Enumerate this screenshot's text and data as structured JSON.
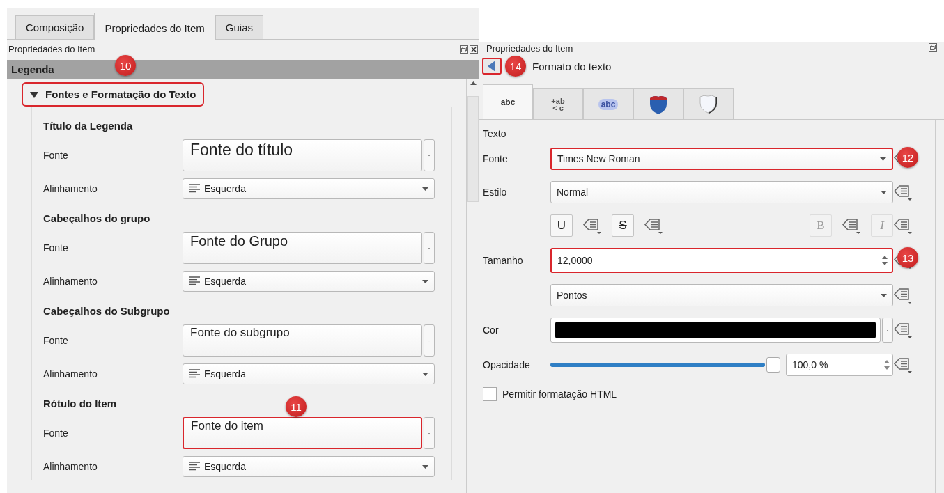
{
  "left_panel": {
    "tabs": [
      {
        "label": "Composição",
        "selected": false
      },
      {
        "label": "Propriedades do Item",
        "selected": true
      },
      {
        "label": "Guias",
        "selected": false
      }
    ],
    "title": "Propriedades do Item",
    "section_bar": "Legenda",
    "group": {
      "label": "Fontes e Formatação do Texto",
      "expanded": true,
      "highlighted": true,
      "badge": "10"
    },
    "subsections": [
      {
        "heading": "Título da Legenda",
        "rows": [
          {
            "kind": "font",
            "label": "Fonte",
            "value": "Fonte do título",
            "highlighted": false
          },
          {
            "kind": "align",
            "label": "Alinhamento",
            "value": "Esquerda"
          }
        ]
      },
      {
        "heading": "Cabeçalhos do grupo",
        "rows": [
          {
            "kind": "font",
            "label": "Fonte",
            "value": "Fonte do Grupo",
            "highlighted": false
          },
          {
            "kind": "align",
            "label": "Alinhamento",
            "value": "Esquerda"
          }
        ]
      },
      {
        "heading": "Cabeçalhos do Subgrupo",
        "rows": [
          {
            "kind": "font",
            "label": "Fonte",
            "value": "Fonte do subgrupo",
            "highlighted": false
          },
          {
            "kind": "align",
            "label": "Alinhamento",
            "value": "Esquerda"
          }
        ]
      },
      {
        "heading": "Rótulo do Item",
        "rows": [
          {
            "kind": "font",
            "label": "Fonte",
            "value": "Fonte do item",
            "highlighted": true,
            "badge": "11"
          },
          {
            "kind": "align",
            "label": "Alinhamento",
            "value": "Esquerda"
          }
        ]
      }
    ]
  },
  "right_panel": {
    "title": "Propriedades do Item",
    "back_button": {
      "highlighted": true,
      "badge": "14"
    },
    "heading": "Formato do texto",
    "tabs": [
      {
        "kind": "text",
        "glyph": "abc",
        "selected": true
      },
      {
        "kind": "formatting",
        "glyph_lines": [
          "+ab",
          "< c"
        ],
        "selected": false
      },
      {
        "kind": "buffer",
        "glyph": "abc",
        "selected": false
      },
      {
        "kind": "background",
        "selected": false
      },
      {
        "kind": "shadow",
        "selected": false
      }
    ],
    "section": "Texto",
    "rows": [
      {
        "kind": "combo",
        "label": "Fonte",
        "value": "Times New Roman",
        "highlighted": true,
        "badge": "12"
      },
      {
        "kind": "combo",
        "label": "Estilo",
        "value": "Normal",
        "highlighted": false
      },
      {
        "kind": "styles",
        "buttons": [
          {
            "glyph": "U",
            "disabled": false
          },
          {
            "glyph": "S",
            "disabled": false
          },
          {
            "glyph": "B",
            "disabled": true
          },
          {
            "glyph": "I",
            "disabled": true
          }
        ]
      },
      {
        "kind": "spin",
        "label": "Tamanho",
        "value": "12,0000",
        "highlighted": true,
        "badge": "13"
      },
      {
        "kind": "combo",
        "value": "Pontos",
        "highlighted": false
      },
      {
        "kind": "color",
        "label": "Cor",
        "color": "#000000"
      },
      {
        "kind": "slider",
        "label": "Opacidade",
        "level": 1,
        "reading": "100,0 %"
      },
      {
        "kind": "checkbox",
        "label": "Permitir formatação HTML",
        "checked": false
      }
    ]
  }
}
